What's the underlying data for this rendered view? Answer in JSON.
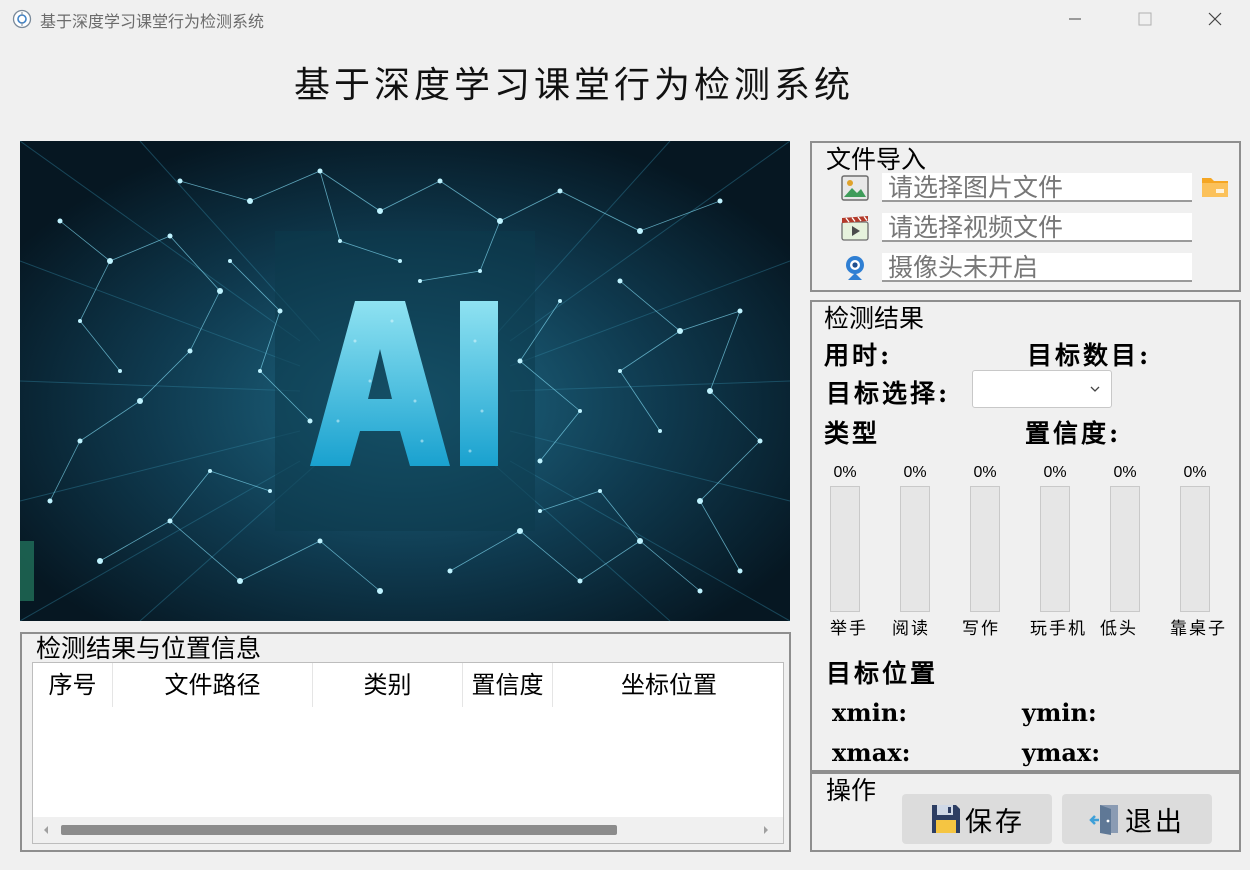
{
  "window": {
    "title": "基于深度学习课堂行为检测系统",
    "controls": {
      "minimize": "minimize-icon",
      "maximize": "maximize-icon",
      "close": "close-icon"
    }
  },
  "header": {
    "title": "基于深度学习课堂行为检测系统"
  },
  "hero": {
    "text": "AI",
    "accent_color": "#47d0f2",
    "background_color": "#0a2534"
  },
  "file_import": {
    "title": "文件导入",
    "image_placeholder": "请选择图片文件",
    "video_placeholder": "请选择视频文件",
    "camera_status": "摄像头未开启"
  },
  "detection": {
    "title": "检测结果",
    "time_label": "用时:",
    "count_label": "目标数目:",
    "select_label": "目标选择:",
    "select_value": "",
    "type_label": "类型",
    "confidence_label": "置信度:",
    "bars": [
      {
        "name": "举手",
        "percent_text": "0%",
        "value": 0
      },
      {
        "name": "阅读",
        "percent_text": "0%",
        "value": 0
      },
      {
        "name": "写作",
        "percent_text": "0%",
        "value": 0
      },
      {
        "name": "玩手机",
        "percent_text": "0%",
        "value": 0
      },
      {
        "name": "低头",
        "percent_text": "0%",
        "value": 0
      },
      {
        "name": "靠桌子",
        "percent_text": "0%",
        "value": 0
      }
    ],
    "position_title": "目标位置",
    "xmin_label": "xmin:",
    "ymin_label": "ymin:",
    "xmax_label": "xmax:",
    "ymax_label": "ymax:"
  },
  "results_table": {
    "title": "检测结果与位置信息",
    "columns": [
      "序号",
      "文件路径",
      "类别",
      "置信度",
      "坐标位置"
    ],
    "rows": []
  },
  "operations": {
    "title": "操作",
    "save_label": "保存",
    "exit_label": "退出"
  }
}
